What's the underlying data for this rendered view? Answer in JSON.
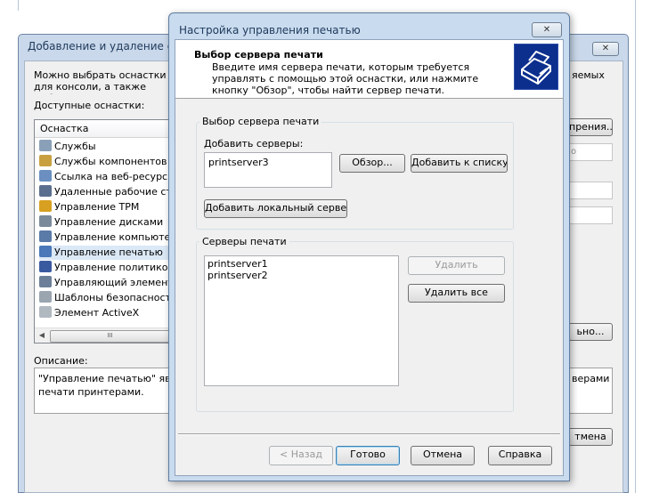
{
  "back_window": {
    "title": "Добавление и удаление оснастки",
    "description_left": "Можно выбрать оснастки для консоли, а также выбрать, какие расширения оснасток можно настроить тр",
    "description_right": "яемых",
    "available_label": "Доступные оснастки:",
    "list_header": "Оснастка",
    "items": [
      {
        "label": "Службы",
        "icon": "gears-icon",
        "color": "#8aa0b8"
      },
      {
        "label": "Службы компонентов",
        "icon": "components-icon",
        "color": "#c8a040"
      },
      {
        "label": "Ссылка на веб-ресурс",
        "icon": "web-link-icon",
        "color": "#6a8fc0"
      },
      {
        "label": "Удаленные рабочие столы",
        "icon": "remote-desktop-icon",
        "color": "#5a6f8e"
      },
      {
        "label": "Управление TPM",
        "icon": "tpm-icon",
        "color": "#d8a020"
      },
      {
        "label": "Управление дисками",
        "icon": "disk-icon",
        "color": "#7a8a9a"
      },
      {
        "label": "Управление компьютером",
        "icon": "computer-management-icon",
        "color": "#5a7aa8"
      },
      {
        "label": "Управление печатью",
        "icon": "printer-icon",
        "color": "#4a78b8"
      },
      {
        "label": "Управление политикой IP",
        "icon": "ip-policy-icon",
        "color": "#3a5aa0"
      },
      {
        "label": "Управляющий элемент WMI",
        "icon": "wmi-icon",
        "color": "#6c7f99"
      },
      {
        "label": "Шаблоны безопасности",
        "icon": "security-template-icon",
        "color": "#9aa5b0"
      },
      {
        "label": "Элемент ActiveX",
        "icon": "activex-icon",
        "color": "#b0b8c0"
      }
    ],
    "selected_index": 7,
    "scroll_thumb": "III",
    "right_button_1": "прения...",
    "right_field_1": "о",
    "right_button_2": "ьно...",
    "description_label": "Описание:",
    "description_text": "\"Управление печатью\" являет",
    "description_text_2": "печати принтерами.",
    "description_right_text": "верами",
    "right_button_3": "тмена"
  },
  "dialog": {
    "title": "Настройка управления печатью",
    "close_label": "☒",
    "header_title": "Выбор сервера печати",
    "header_subtitle": "Введите имя сервера печати, которым требуется управлять с помощью этой оснастки, или нажмите кнопку \"Обзор\", чтобы найти сервер печати.",
    "group1_label": "Выбор сервера печати",
    "add_servers_label": "Добавить серверы:",
    "add_input_value": "printserver3",
    "browse_label": "Обзор...",
    "add_to_list_label": "Добавить к списку",
    "add_local_label": "Добавить локальный сервер",
    "group2_label": "Серверы печати",
    "servers": [
      "printserver1",
      "printserver2"
    ],
    "remove_label": "Удалить",
    "remove_all_label": "Удалить все",
    "back_label": "< Назад",
    "finish_label": "Готово",
    "cancel_label": "Отмена",
    "help_label": "Справка"
  }
}
